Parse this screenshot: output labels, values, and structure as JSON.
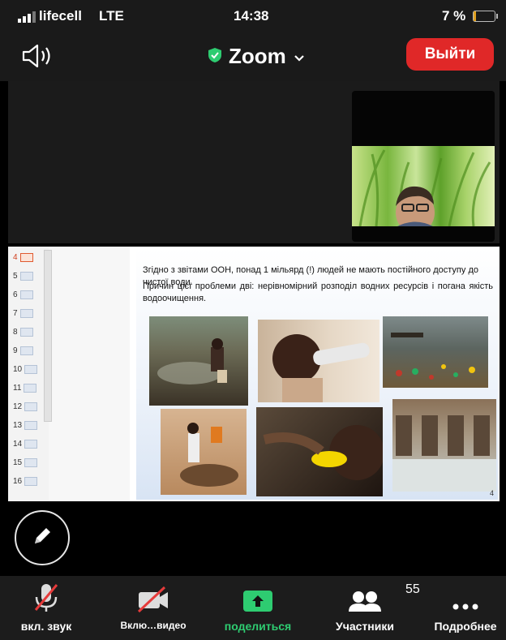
{
  "status_bar": {
    "carrier": "lifecell",
    "network": "LTE",
    "time": "14:38",
    "battery": "7 %"
  },
  "header": {
    "title": "Zoom",
    "leave_label": "Выйти"
  },
  "slide": {
    "line1": "Згідно з звітами ООН, понад 1 мільярд (!) людей не мають постійного доступу до чистої води.",
    "line2": "Причин цієї проблеми дві: нерівномірний розподіл водних ресурсів і погана якість водоочищення.",
    "page_number": "4"
  },
  "slide_thumbnails": [
    "4",
    "5",
    "6",
    "7",
    "8",
    "9",
    "10",
    "11",
    "12",
    "13",
    "14",
    "15",
    "16"
  ],
  "toolbar": {
    "audio_label": "вкл. звук",
    "video_label": "Вклю…видео",
    "share_label": "поделиться",
    "participants_label": "Участники",
    "participants_count": "55",
    "more_label": "Подробнее"
  },
  "colors": {
    "leave": "#e02828",
    "share": "#2ecc71",
    "shield": "#2ecc71",
    "mute_slash": "#e63b3b"
  },
  "icons": [
    "signal-icon",
    "battery-icon",
    "speaker-icon",
    "shield-check-icon",
    "chevron-down-icon",
    "pencil-icon",
    "mic-off-icon",
    "video-off-icon",
    "share-arrow-icon",
    "participants-icon",
    "more-dots-icon"
  ]
}
